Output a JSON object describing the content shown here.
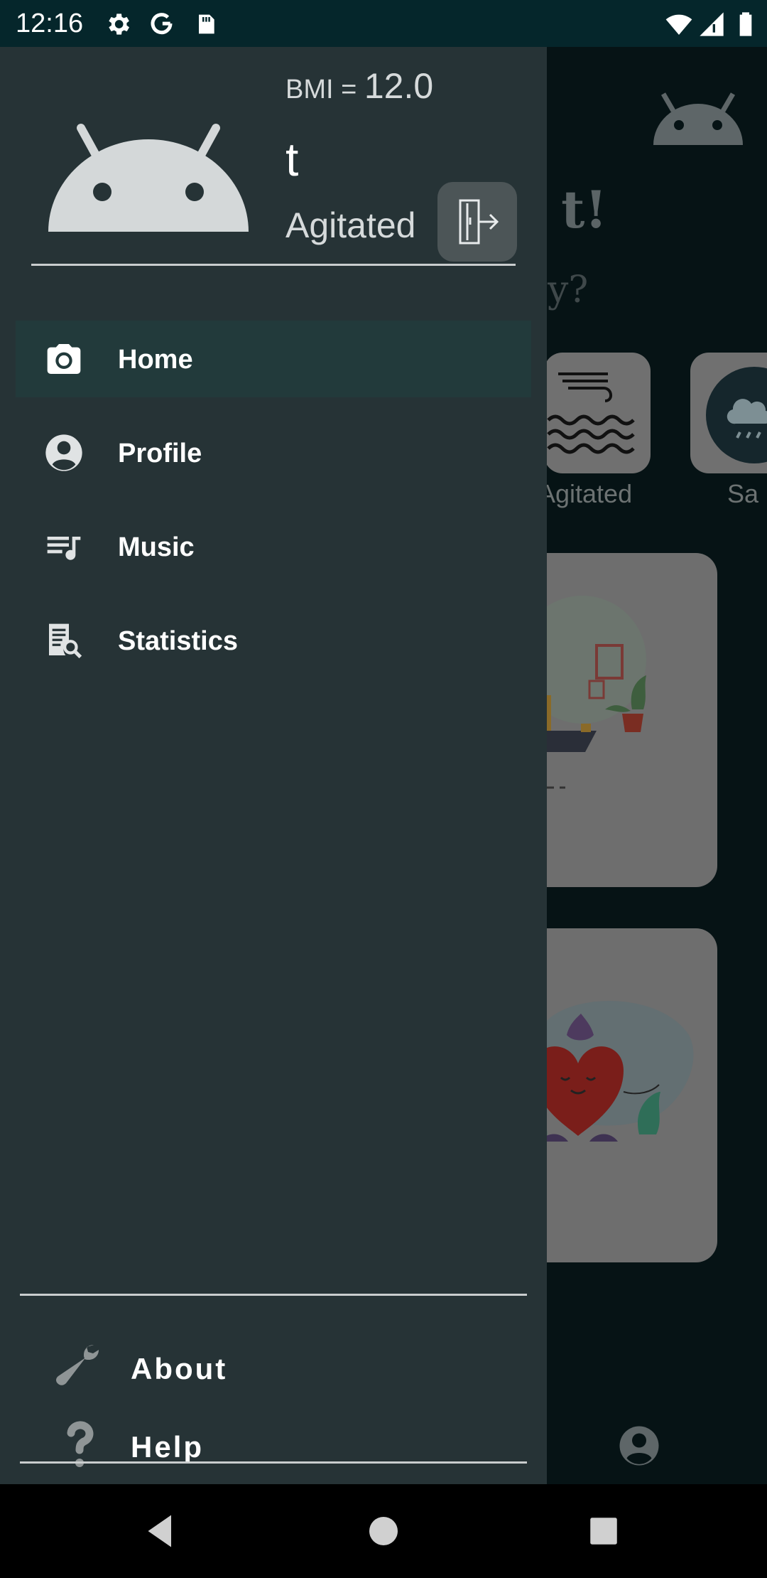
{
  "status_bar": {
    "time": "12:16",
    "icons": [
      "settings-icon",
      "google-icon",
      "sd-card-icon",
      "wifi-icon",
      "signal-icon",
      "battery-icon"
    ]
  },
  "drawer": {
    "header": {
      "bmi_label": "BMI = ",
      "bmi_value": "12.0",
      "username": "t",
      "mood": "Agitated",
      "avatar_icon": "android-icon",
      "logout_icon": "logout-icon"
    },
    "nav_items": [
      {
        "label": "Home",
        "icon": "camera-icon",
        "selected": true
      },
      {
        "label": "Profile",
        "icon": "account-circle-icon",
        "selected": false
      },
      {
        "label": "Music",
        "icon": "playlist-music-icon",
        "selected": false
      },
      {
        "label": "Statistics",
        "icon": "report-search-icon",
        "selected": false
      }
    ],
    "footer_items": [
      {
        "label": "About",
        "icon": "wrench-icon"
      },
      {
        "label": "Help",
        "icon": "question-icon"
      }
    ]
  },
  "background": {
    "greeting": ", t!",
    "question": "ay?",
    "moods": [
      {
        "label": "Agitated",
        "icon": "wind-waves-icon"
      },
      {
        "label": "Sa",
        "icon": "sad-cloud-icon"
      }
    ]
  },
  "nav_bar": {
    "buttons": [
      "back-icon",
      "home-icon",
      "recents-icon"
    ]
  },
  "colors": {
    "drawer_bg": "#263336",
    "selected_item_bg": "#223a3b",
    "status_bar": "#05262b",
    "scrim_bg": "#061315"
  }
}
